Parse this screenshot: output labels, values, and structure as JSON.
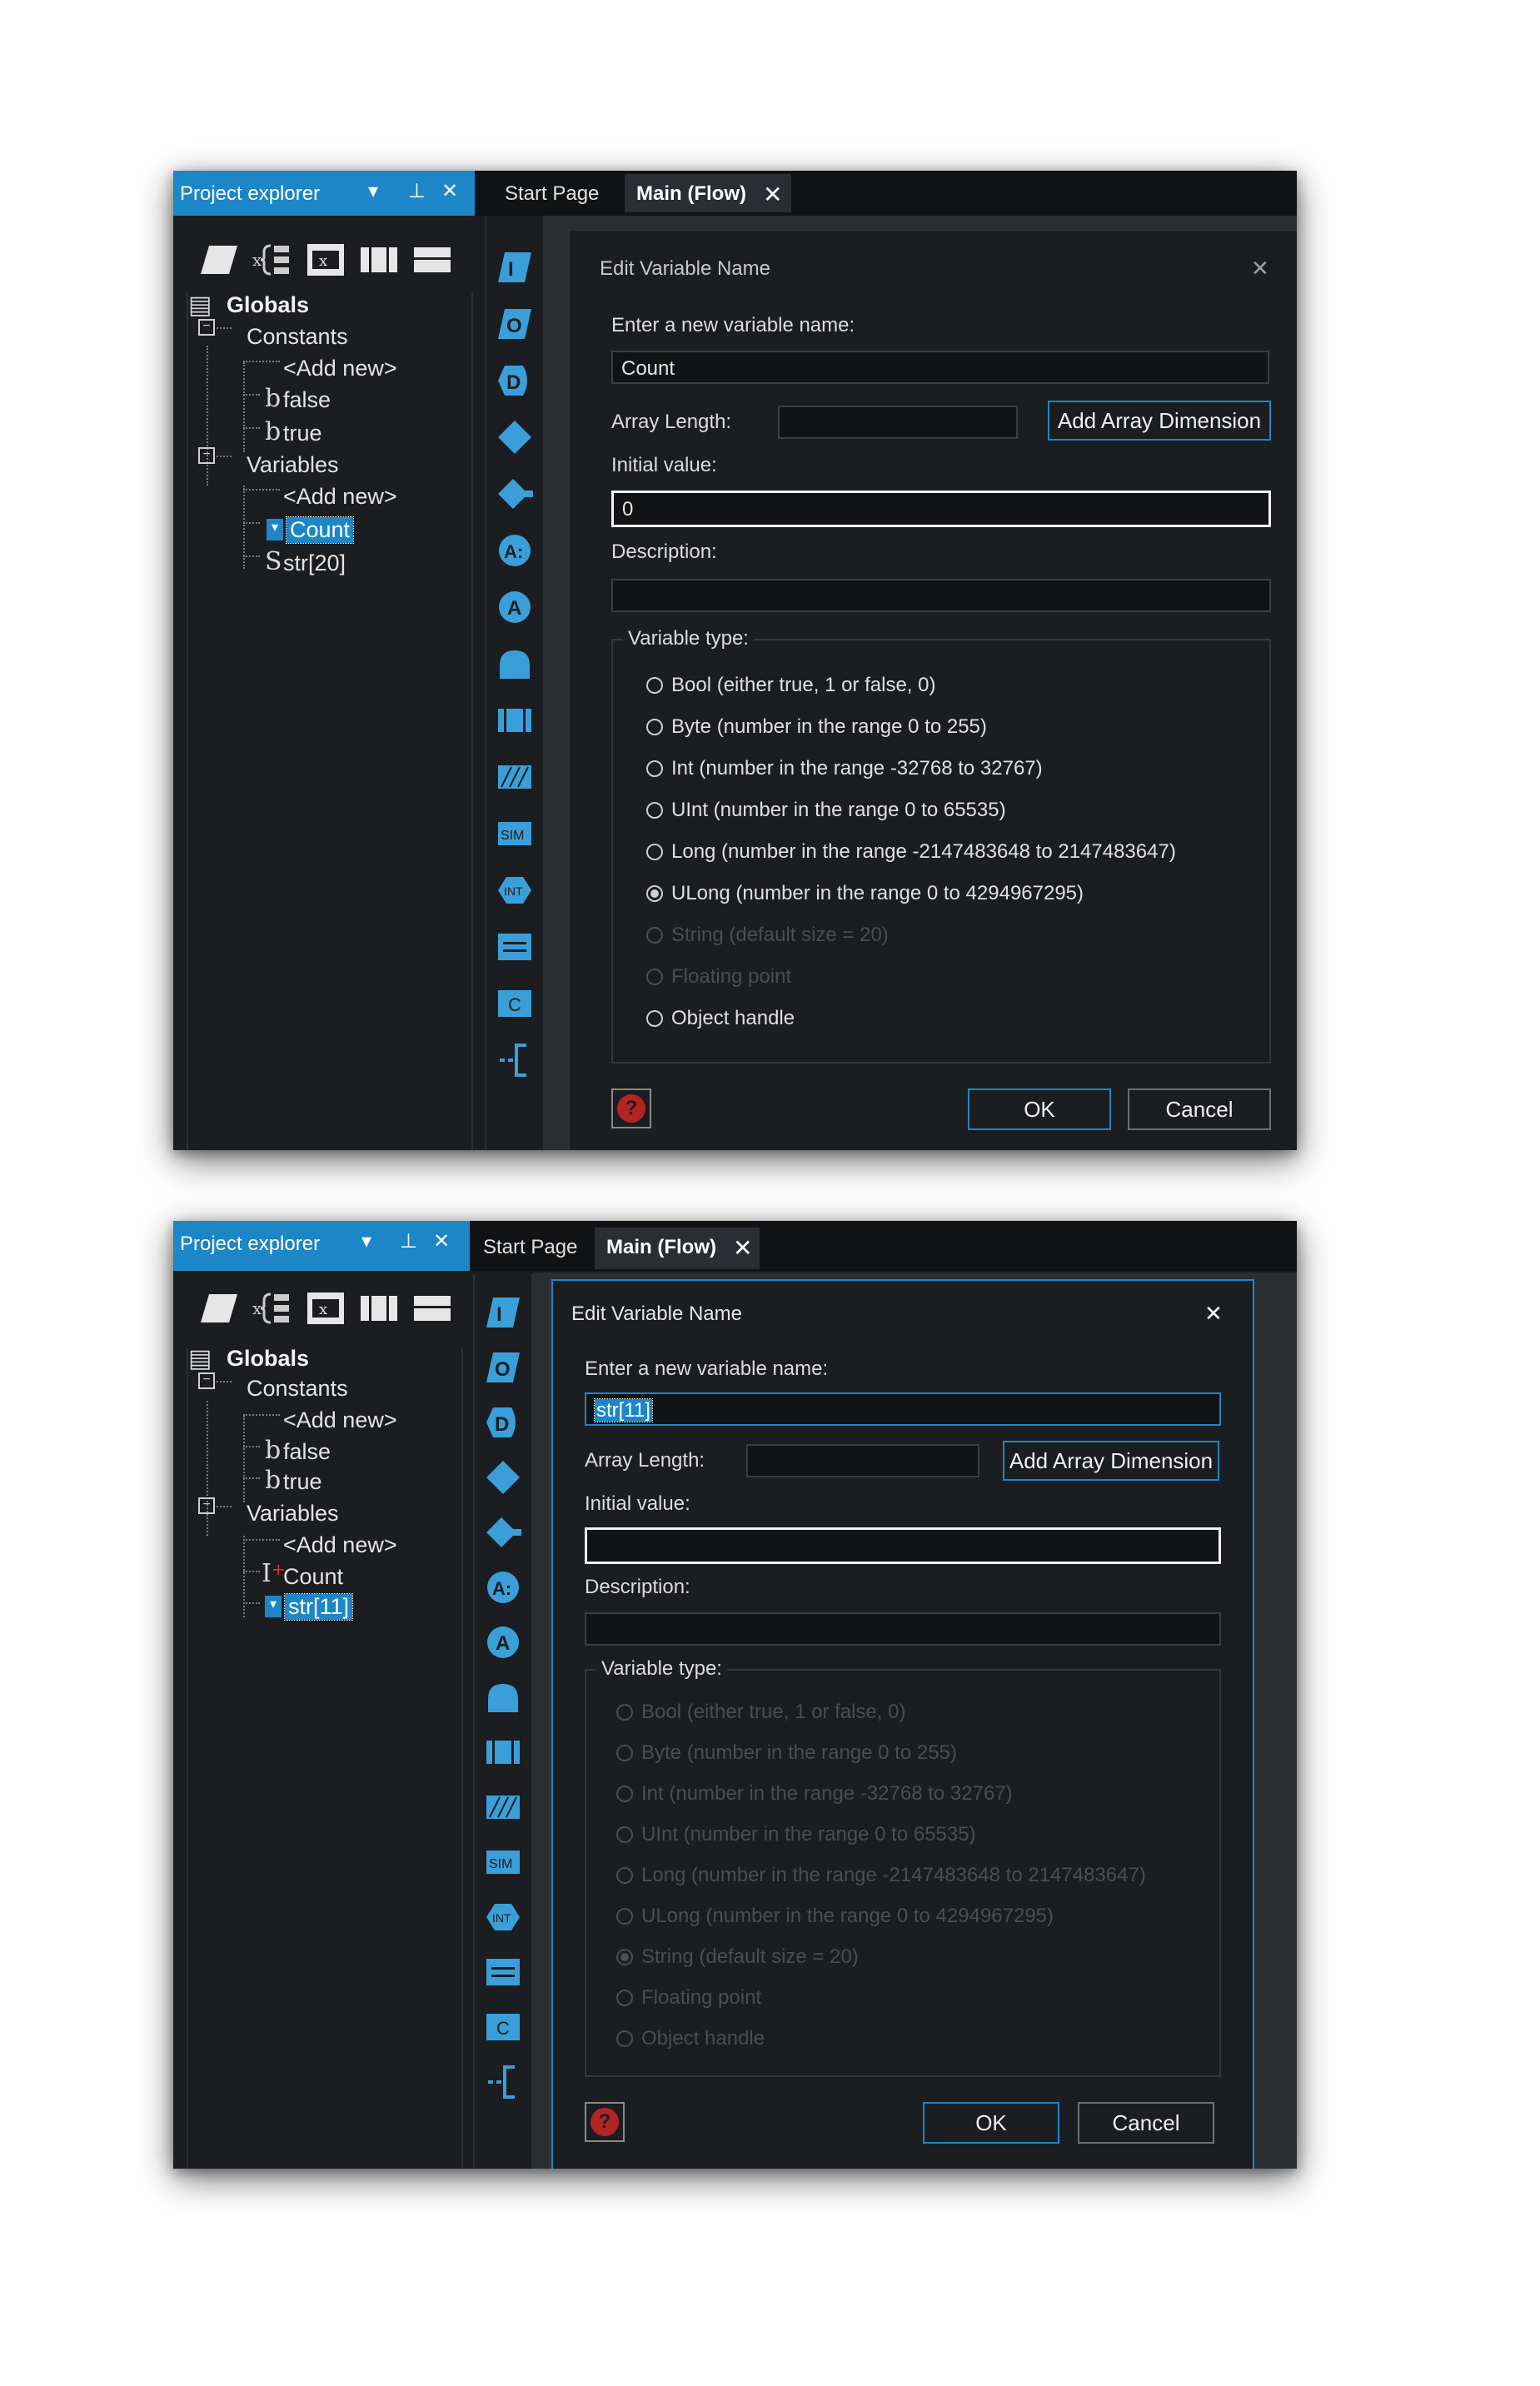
{
  "panel": {
    "title": "Project explorer",
    "dropdown": "▾",
    "pin": "⊥",
    "close": "✕"
  },
  "tabs": {
    "start": "Start Page",
    "main": "Main (Flow)",
    "close": "✕"
  },
  "tree1": {
    "globals": "Globals",
    "constants": "Constants",
    "add_new": "<Add new>",
    "const_items": [
      "false",
      "true"
    ],
    "variables": "Variables",
    "var_items": [
      "Count",
      "str[20]"
    ]
  },
  "tree2": {
    "globals": "Globals",
    "constants": "Constants",
    "add_new": "<Add new>",
    "const_items": [
      "false",
      "true"
    ],
    "variables": "Variables",
    "var_items": [
      "Count",
      "str[11]"
    ]
  },
  "palette": {
    "labels": [
      "I",
      "O",
      "D",
      "A:",
      "A",
      "SIM",
      "INT",
      "C"
    ]
  },
  "dialog1": {
    "title": "Edit Variable Name",
    "name_label": "Enter a new variable name:",
    "name_value": "Count",
    "array_label": "Array Length:",
    "array_value": "",
    "add_dim": "Add Array Dimension",
    "init_label": "Initial value:",
    "init_value": "0",
    "desc_label": "Description:",
    "desc_value": "",
    "type_label": "Variable type:",
    "types": [
      "Bool (either true, 1 or false, 0)",
      "Byte (number in the range 0 to 255)",
      "Int (number in the range -32768 to 32767)",
      "UInt (number in the range 0 to 65535)",
      "Long (number in the range -2147483648 to 2147483647)",
      "ULong (number in the range 0 to 4294967295)",
      "String (default size = 20)",
      "Floating point",
      "Object handle"
    ],
    "ok": "OK",
    "cancel": "Cancel",
    "help": "?"
  },
  "dialog2": {
    "title": "Edit Variable Name",
    "name_label": "Enter a new variable name:",
    "name_value": "str[11]",
    "array_label": "Array Length:",
    "array_value": "",
    "add_dim": "Add Array Dimension",
    "init_label": "Initial value:",
    "init_value": "",
    "desc_label": "Description:",
    "desc_value": "",
    "type_label": "Variable type:",
    "types": [
      "Bool (either true, 1 or false, 0)",
      "Byte (number in the range 0 to 255)",
      "Int (number in the range -32768 to 32767)",
      "UInt (number in the range 0 to 65535)",
      "Long (number in the range -2147483648 to 2147483647)",
      "ULong (number in the range 0 to 4294967295)",
      "String (default size = 20)",
      "Floating point",
      "Object handle"
    ],
    "ok": "OK",
    "cancel": "Cancel",
    "help": "?"
  },
  "colors": {
    "accent": "#1c86c6",
    "bg": "#1b1d20",
    "help_red": "#b32525"
  }
}
